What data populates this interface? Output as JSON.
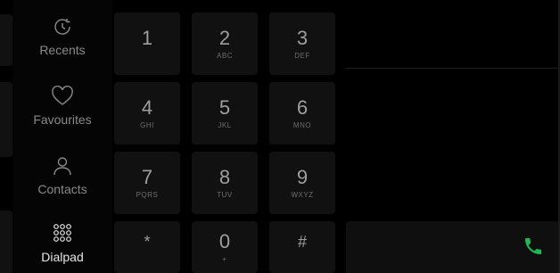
{
  "nav": {
    "items": [
      {
        "label": "Recents",
        "icon": "recents-icon",
        "active": false
      },
      {
        "label": "Favourites",
        "icon": "heart-icon",
        "active": false
      },
      {
        "label": "Contacts",
        "icon": "person-icon",
        "active": false
      },
      {
        "label": "Dialpad",
        "icon": "dialpad-icon",
        "active": true
      }
    ]
  },
  "dialpad": {
    "keys": [
      {
        "digit": "1",
        "letters": ""
      },
      {
        "digit": "2",
        "letters": "ABC"
      },
      {
        "digit": "3",
        "letters": "DEF"
      },
      {
        "digit": "4",
        "letters": "GHI"
      },
      {
        "digit": "5",
        "letters": "JKL"
      },
      {
        "digit": "6",
        "letters": "MNO"
      },
      {
        "digit": "7",
        "letters": "PQRS"
      },
      {
        "digit": "8",
        "letters": "TUV"
      },
      {
        "digit": "9",
        "letters": "WXYZ"
      },
      {
        "digit": "*",
        "letters": ""
      },
      {
        "digit": "0",
        "letters": "+"
      },
      {
        "digit": "#",
        "letters": ""
      }
    ]
  },
  "number_display": {
    "value": ""
  },
  "call": {
    "icon": "phone-icon",
    "color": "#1db954"
  },
  "colors": {
    "background": "#000000",
    "key": "#111111",
    "accent": "#1db954"
  }
}
